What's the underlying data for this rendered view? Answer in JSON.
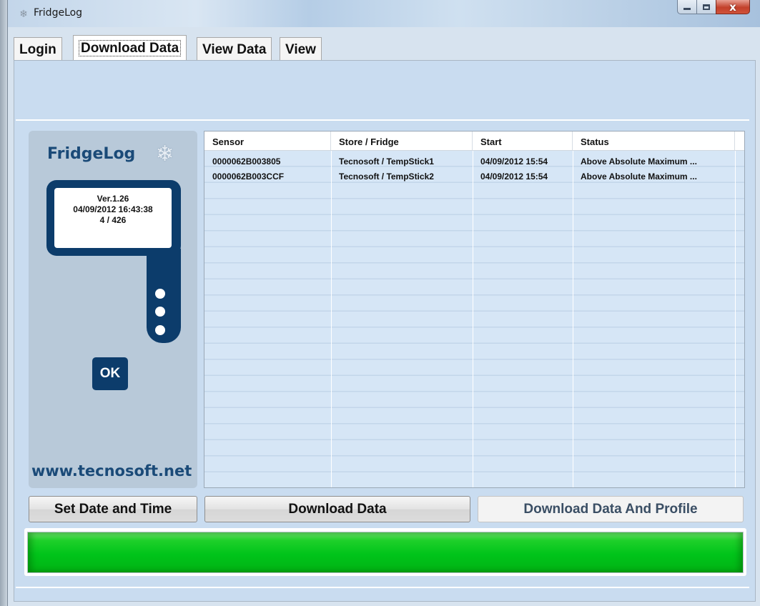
{
  "window": {
    "title": "FridgeLog",
    "icon": "snowflake-icon"
  },
  "tabs": [
    {
      "label": "Login"
    },
    {
      "label": "Download Data"
    },
    {
      "label": "View Data"
    },
    {
      "label": "View"
    }
  ],
  "device": {
    "brand": "FridgeLog",
    "version": "Ver.1.26",
    "datetime": "04/09/2012 16:43:38",
    "count": "4 / 426",
    "ok_label": "OK",
    "website": "www.tecnosoft.net"
  },
  "table": {
    "columns": [
      "Sensor",
      "Store / Fridge",
      "Start",
      "Status"
    ],
    "rows": [
      [
        "0000062B003805",
        "Tecnosoft / TempStick1",
        "04/09/2012 15:54",
        "Above Absolute Maximum ..."
      ],
      [
        "0000062B003CCF",
        "Tecnosoft / TempStick2",
        "04/09/2012 15:54",
        "Above Absolute Maximum ..."
      ]
    ]
  },
  "buttons": {
    "set_date_time": "Set Date and Time",
    "download_data": "Download Data",
    "download_data_profile": "Download Data And Profile"
  },
  "progress": {
    "percent": 100,
    "color": "#00c41a"
  }
}
